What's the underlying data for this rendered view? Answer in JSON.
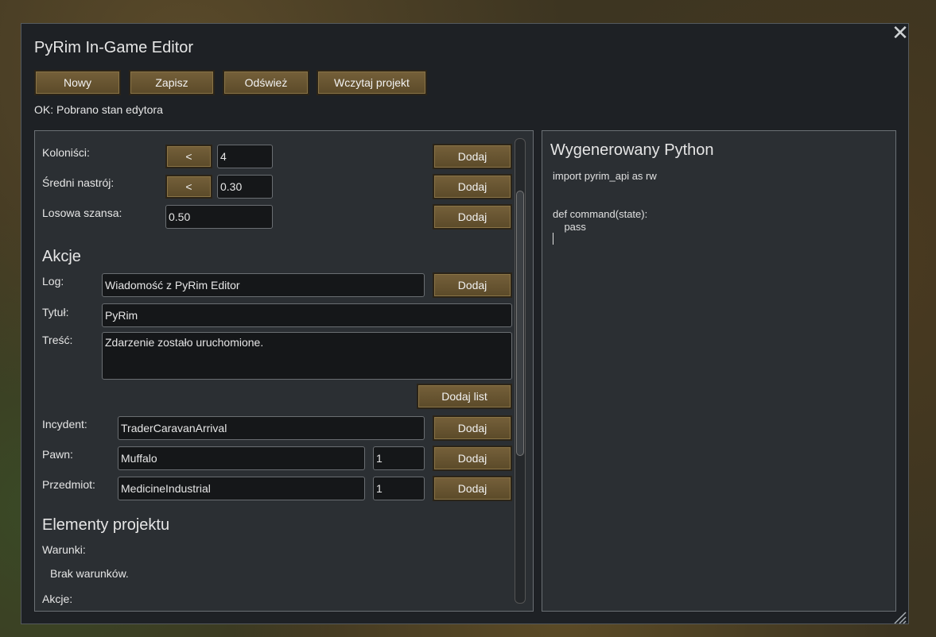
{
  "window": {
    "title": "PyRim In-Game Editor",
    "close_icon": "close-icon"
  },
  "toolbar": {
    "new_label": "Nowy",
    "save_label": "Zapisz",
    "refresh_label": "Odśwież",
    "load_label": "Wczytaj projekt"
  },
  "status": "OK: Pobrano stan edytora",
  "conditions": {
    "colonists": {
      "label": "Koloniści:",
      "op": "<",
      "value": "4",
      "add": "Dodaj"
    },
    "mood": {
      "label": "Średni nastrój:",
      "op": "<",
      "value": "0.30",
      "add": "Dodaj"
    },
    "chance": {
      "label": "Losowa szansa:",
      "value": "0.50",
      "add": "Dodaj"
    }
  },
  "actions": {
    "heading": "Akcje",
    "log": {
      "label": "Log:",
      "value": "Wiadomość z PyRim Editor",
      "add": "Dodaj"
    },
    "title": {
      "label": "Tytuł:",
      "value": "PyRim"
    },
    "body": {
      "label": "Treść:",
      "value": "Zdarzenie zostało uruchomione."
    },
    "add_letter": "Dodaj list",
    "incident": {
      "label": "Incydent:",
      "value": "TraderCaravanArrival",
      "add": "Dodaj"
    },
    "pawn": {
      "label": "Pawn:",
      "value": "Muffalo",
      "count": "1",
      "add": "Dodaj"
    },
    "item": {
      "label": "Przedmiot:",
      "value": "MedicineIndustrial",
      "count": "1",
      "add": "Dodaj"
    }
  },
  "project": {
    "heading": "Elementy projektu",
    "conditions_label": "Warunki:",
    "no_conditions": "Brak warunków.",
    "actions_label": "Akcje:"
  },
  "python": {
    "heading": "Wygenerowany Python",
    "line1": "import pyrim_api as rw",
    "line2": "def command(state):",
    "line3": "    pass"
  }
}
